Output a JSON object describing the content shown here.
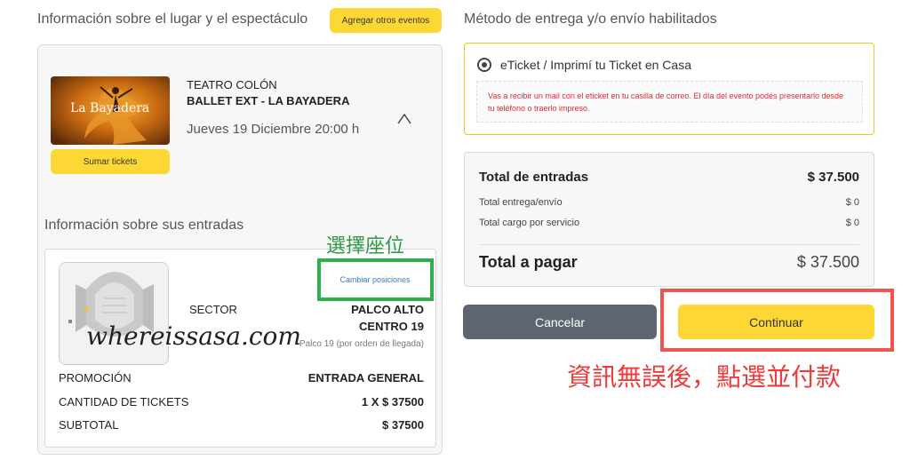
{
  "left_panel": {
    "title": "Información sobre el lugar y el espectáculo",
    "add_events_label": "Agregar otros eventos",
    "event": {
      "poster_text": "La Bayadera",
      "venue": "TEATRO COLÓN",
      "show": "BALLET EXT - LA BAYADERA",
      "date": "Jueves 19 Diciembre 20:00 h",
      "add_tickets_label": "Sumar tickets"
    },
    "entries_title": "Información sobre sus entradas",
    "ticket": {
      "change_positions_label": "Cambiar posiciones",
      "sector_label": "SECTOR",
      "sector_name": "PALCO ALTO",
      "sector_sub": "CENTRO 19",
      "sector_note": "Palco 19 (por orden de llegada)",
      "rows": [
        {
          "label": "PROMOCIÓN",
          "value": "ENTRADA GENERAL"
        },
        {
          "label": "CANTIDAD DE TICKETS",
          "value": "1 X $ 37500"
        },
        {
          "label": "SUBTOTAL",
          "value": "$ 37500"
        }
      ]
    }
  },
  "right_panel": {
    "title": "Método de entrega y/o envío habilitados",
    "delivery_option": "eTicket / Imprimí tu Ticket en Casa",
    "delivery_note": "Vas a recibir un mail con el eticket en tu casilla de correo. El día del evento podés presentarlo desde tu teléfono o traerlo impreso.",
    "totals": {
      "entries_label": "Total de entradas",
      "entries_value": "$ 37.500",
      "shipping_label": "Total entrega/envío",
      "shipping_value": "$ 0",
      "service_label": "Total cargo por servicio",
      "service_value": "$ 0",
      "pay_label": "Total a pagar",
      "pay_value": "$ 37.500"
    },
    "cancel_label": "Cancelar",
    "continue_label": "Continuar"
  },
  "annotations": {
    "select_seats": "選擇座位",
    "confirm_pay": "資訊無誤後，點選並付款",
    "watermark": "whereissasa.com"
  },
  "colors": {
    "accent_yellow": "#fdd835",
    "cancel_gray": "#5c6570",
    "annotation_green": "#2db04b",
    "annotation_red": "#ef5350"
  }
}
